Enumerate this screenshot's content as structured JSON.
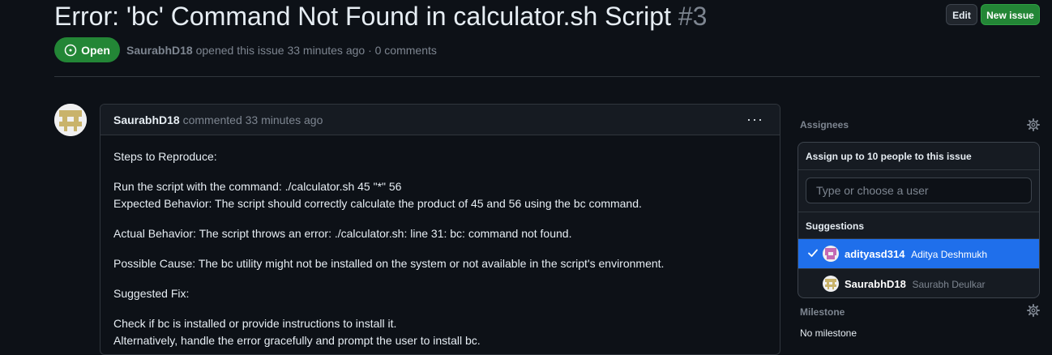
{
  "issue": {
    "title": "Error: 'bc' Command Not Found in calculator.sh Script",
    "number": "#3",
    "state": "Open",
    "author": "SaurabhD18",
    "meta_text": "opened this issue 33 minutes ago · 0 comments"
  },
  "header_buttons": {
    "edit": "Edit",
    "new_issue": "New issue"
  },
  "comment": {
    "author": "SaurabhD18",
    "action": "commented 33 minutes ago",
    "more": "···",
    "lines": [
      "Steps to Reproduce:",
      "Run the script with the command: ./calculator.sh 45 \"*\" 56",
      "Expected Behavior: The script should correctly calculate the product of 45 and 56 using the bc command.",
      "Actual Behavior: The script throws an error: ./calculator.sh: line 31: bc: command not found.",
      "Possible Cause: The bc utility might not be installed on the system or not available in the script's environment.",
      "Suggested Fix:",
      "Check if bc is installed or provide instructions to install it.",
      "Alternatively, handle the error gracefully and prompt the user to install bc."
    ]
  },
  "sidebar": {
    "assignees_label": "Assignees",
    "milestone_label": "Milestone",
    "milestone_value": "No milestone"
  },
  "assign_dropdown": {
    "title": "Assign up to 10 people to this issue",
    "placeholder": "Type or choose a user",
    "suggestions_label": "Suggestions",
    "users": [
      {
        "login": "adityasd314",
        "name": "Aditya Deshmukh",
        "selected": true
      },
      {
        "login": "SaurabhD18",
        "name": "Saurabh Deulkar",
        "selected": false
      }
    ]
  },
  "colors": {
    "open_green": "#238636",
    "accent_blue": "#1f6feb",
    "bg": "#0d1117"
  }
}
